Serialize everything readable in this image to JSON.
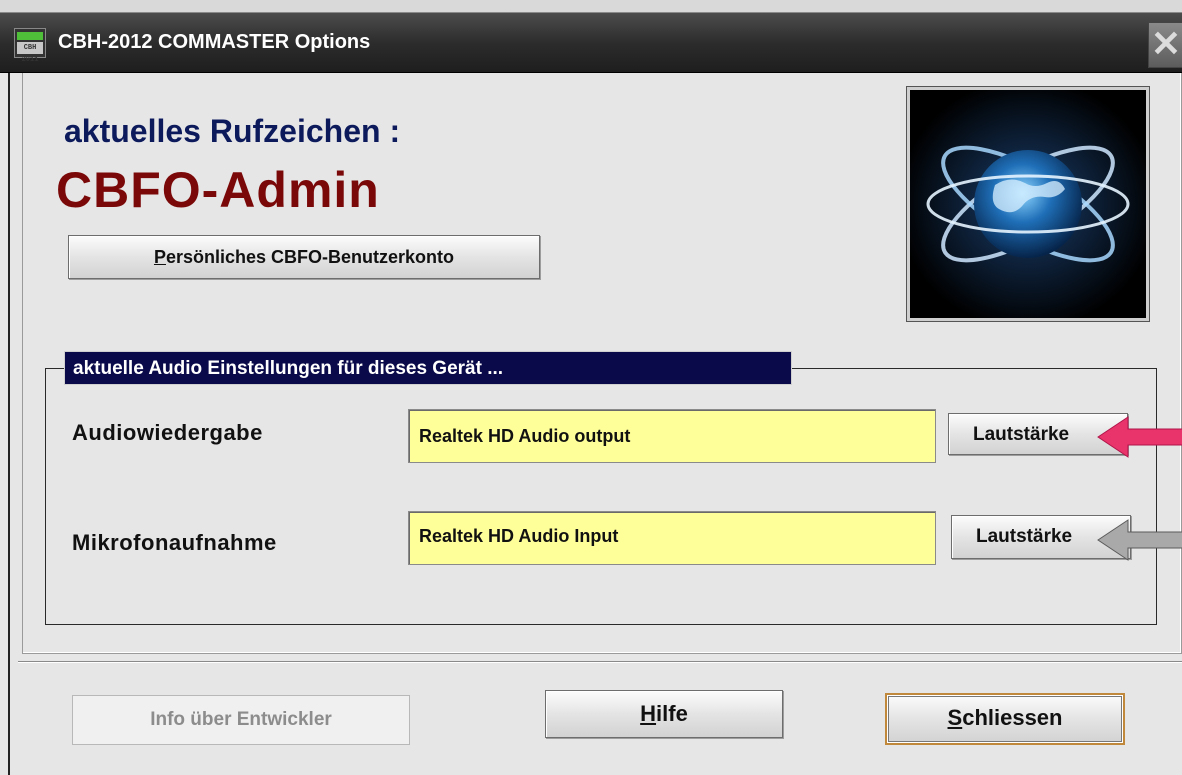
{
  "window": {
    "title": "CBH-2012 COMMASTER Options",
    "icon_text": "CBH 2011",
    "close_symbol": "✕"
  },
  "callsign": {
    "label": "aktuelles Rufzeichen :",
    "value": "CBFO-Admin",
    "account_button": {
      "mnemonic": "P",
      "rest": "ersönliches CBFO-Benutzerkonto"
    }
  },
  "logo": {
    "icon": "globe-orbit-icon"
  },
  "audio": {
    "group_title": "aktuelle Audio Einstellungen für dieses Gerät ...",
    "playback": {
      "label": "Audiowiedergabe",
      "device": "Realtek HD Audio output",
      "volume_label": "Lautstärke"
    },
    "recording": {
      "label": "Mikrofonaufnahme",
      "device": "Realtek HD Audio Input",
      "volume_label": "Lautstärke"
    }
  },
  "arrows": {
    "playback_color": "#e8336b",
    "recording_color": "#a9a9a9"
  },
  "footer": {
    "info_label": "Info über Entwickler",
    "help": {
      "mnemonic": "H",
      "rest": "ilfe"
    },
    "close": {
      "mnemonic": "S",
      "rest": "chliessen"
    }
  },
  "colors": {
    "accent": "#0a0a4a",
    "callsign": "#7a0808",
    "field": "#ffff99"
  }
}
